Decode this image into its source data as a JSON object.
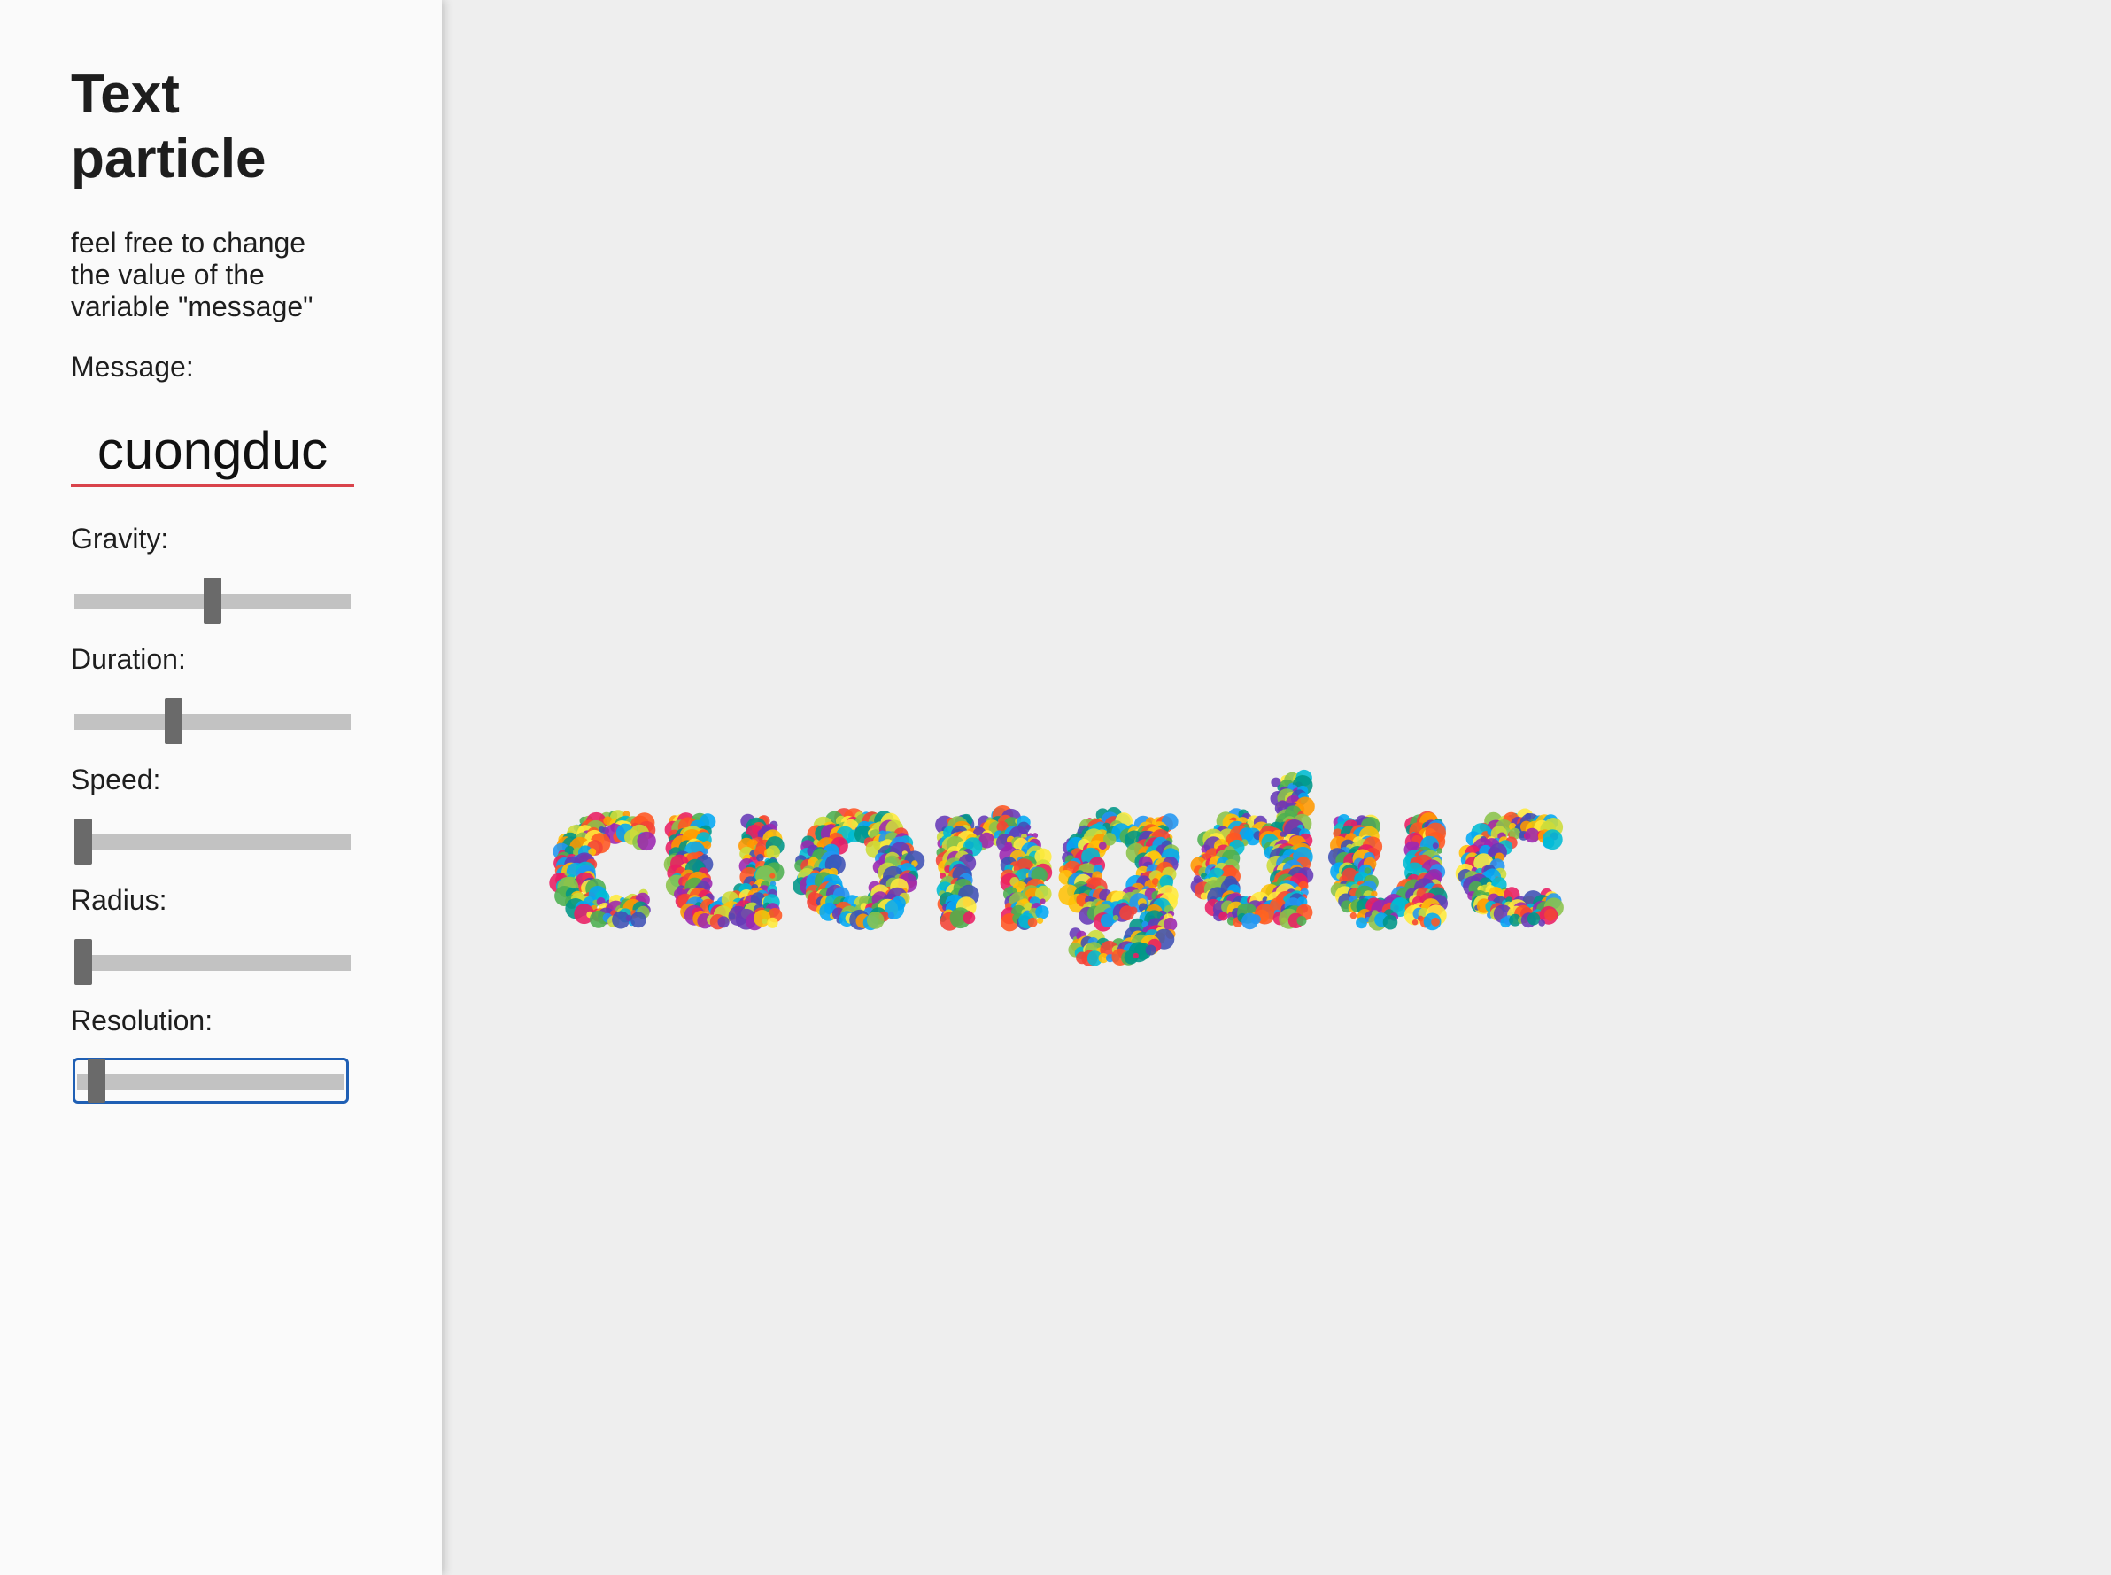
{
  "sidebar": {
    "title": "Text particle",
    "description": "feel free to change\nthe value of the\nvariable \"message\"",
    "message": {
      "label": "Message:",
      "value": "cuongduc"
    },
    "sliders": [
      {
        "id": "gravity",
        "label": "Gravity:",
        "level": 0.5,
        "focused": false
      },
      {
        "id": "duration",
        "label": "Duration:",
        "level": 0.35,
        "focused": false
      },
      {
        "id": "speed",
        "label": "Speed:",
        "level": 0.0,
        "focused": false
      },
      {
        "id": "radius",
        "label": "Radius:",
        "level": 0.0,
        "focused": false
      },
      {
        "id": "resolution",
        "label": "Resolution:",
        "level": 0.05,
        "focused": true
      }
    ]
  },
  "canvas": {
    "text": "cuongduc",
    "particle_colors": [
      "#f44336",
      "#e91e63",
      "#9c27b0",
      "#673ab7",
      "#3f51b5",
      "#2196f3",
      "#03a9f4",
      "#00bcd4",
      "#009688",
      "#4caf50",
      "#8bc34a",
      "#cddc39",
      "#ffeb3b",
      "#ffc107",
      "#ff9800",
      "#ff5722"
    ]
  }
}
